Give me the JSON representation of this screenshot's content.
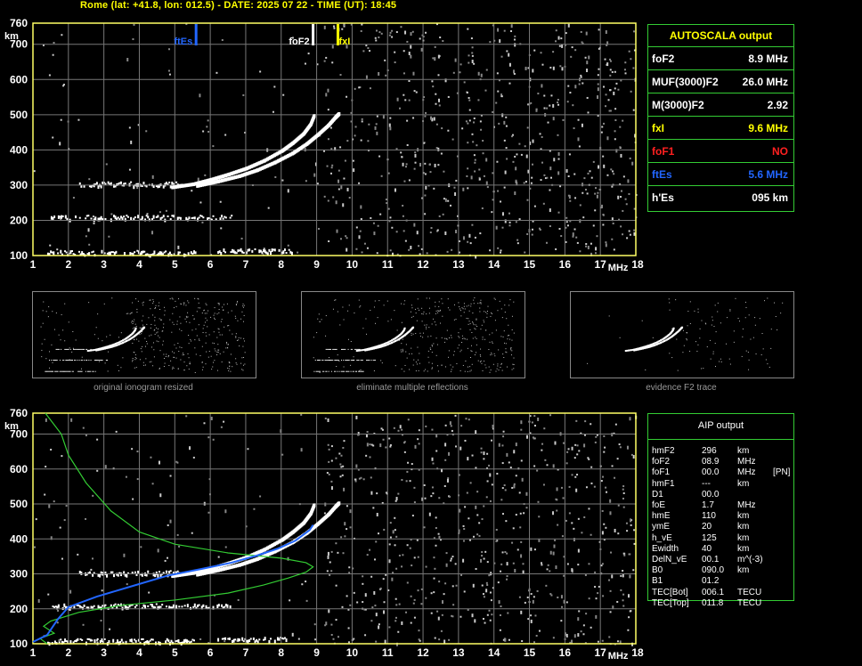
{
  "header": "Rome (lat: +41.8, lon: 012.5) - DATE: 2025 07 22 - TIME (UT): 18:45",
  "colors": {
    "frame": "#ffff66",
    "grid": "#777777",
    "green": "#33cc33",
    "blue": "#2266ff",
    "yellow": "#ffff00",
    "red": "#ff2020"
  },
  "chart_data": [
    {
      "type": "scatter",
      "xlabel": "MHz",
      "ylabel": "km",
      "xlim": [
        1,
        18
      ],
      "ylim": [
        100,
        760
      ],
      "xticks": [
        "1",
        "2",
        "3",
        "4",
        "5",
        "6",
        "7",
        "8",
        "9",
        "10",
        "11",
        "12",
        "13",
        "14",
        "15",
        "16",
        "17",
        "18"
      ],
      "yticks": [
        "100",
        "200",
        "300",
        "400",
        "500",
        "600",
        "700",
        "760"
      ],
      "grid": true,
      "markers": [
        {
          "label": "ftEs",
          "freq": 5.6,
          "color": "#2266ff"
        },
        {
          "label": "foF2",
          "freq": 8.9,
          "color": "#ffffff"
        },
        {
          "label": "fxI",
          "freq": 9.6,
          "color": "#ffff00"
        }
      ],
      "series": [
        {
          "x": [
            4.9,
            5.5,
            6.0,
            6.5,
            7.0,
            7.5,
            8.0,
            8.3,
            8.6,
            8.8,
            8.9
          ],
          "y": [
            296,
            305,
            318,
            333,
            350,
            372,
            400,
            422,
            448,
            475,
            500
          ]
        },
        {
          "x": [
            5.6,
            6.2,
            6.8,
            7.3,
            7.8,
            8.3,
            8.7,
            9.0,
            9.3,
            9.5,
            9.6
          ],
          "y": [
            300,
            313,
            328,
            345,
            367,
            393,
            420,
            445,
            472,
            495,
            505
          ]
        }
      ]
    },
    {
      "type": "line",
      "xlabel": "MHz",
      "ylabel": "km",
      "xlim": [
        1,
        18
      ],
      "ylim": [
        100,
        760
      ],
      "xticks": [
        "1",
        "2",
        "3",
        "4",
        "5",
        "6",
        "7",
        "8",
        "9",
        "10",
        "11",
        "12",
        "13",
        "14",
        "15",
        "16",
        "17",
        "18"
      ],
      "yticks": [
        "100",
        "200",
        "300",
        "400",
        "500",
        "600",
        "700",
        "760"
      ],
      "grid": true,
      "series": [
        {
          "color": "#33cc33",
          "x": [
            1.4,
            1.2,
            1.6,
            1.3,
            1.5,
            2.3,
            3.5,
            5.0,
            6.5,
            7.5,
            8.2,
            8.7,
            8.9,
            8.7,
            8.0,
            6.5,
            5.0,
            4.0,
            3.2,
            2.5,
            2.0,
            1.8,
            1.5,
            1.35
          ],
          "y": [
            100,
            115,
            130,
            150,
            165,
            190,
            210,
            225,
            245,
            268,
            288,
            305,
            320,
            332,
            345,
            360,
            385,
            420,
            480,
            560,
            640,
            700,
            740,
            760
          ]
        },
        {
          "color": "#2266ff",
          "x": [
            1.0,
            1.4,
            1.7,
            2.0,
            2.8,
            3.8,
            4.8,
            5.8,
            6.6,
            7.3,
            7.9,
            8.4,
            8.8,
            8.9
          ],
          "y": [
            105,
            125,
            170,
            205,
            235,
            265,
            295,
            315,
            332,
            352,
            372,
            395,
            425,
            440
          ]
        }
      ]
    }
  ],
  "autoscala": {
    "title": "AUTOSCALA output",
    "rows": [
      {
        "label": "foF2",
        "value": "8.9 MHz",
        "color": "#ffffff"
      },
      {
        "label": "MUF(3000)F2",
        "value": "26.0 MHz",
        "color": "#ffffff"
      },
      {
        "label": "M(3000)F2",
        "value": "2.92",
        "color": "#ffffff"
      },
      {
        "label": "fxI",
        "value": "9.6 MHz",
        "color": "#ffff00"
      },
      {
        "label": "foF1",
        "value": "NO",
        "color": "#ff2020"
      },
      {
        "label": "ftEs",
        "value": "5.6 MHz",
        "color": "#2266ff"
      },
      {
        "label": "h'Es",
        "value": "095     km",
        "color": "#ffffff"
      }
    ]
  },
  "thumbnails": [
    {
      "caption": "original ionogram resized"
    },
    {
      "caption": "eliminate multiple reflections"
    },
    {
      "caption": "evidence F2 trace"
    }
  ],
  "aip": {
    "title": "AIP output",
    "rows": [
      [
        "hmF2",
        "296",
        "km",
        ""
      ],
      [
        "foF2",
        "08.9",
        "MHz",
        ""
      ],
      [
        "foF1",
        "00.0",
        "MHz",
        "[PN]"
      ],
      [
        "hmF1",
        "---",
        "km",
        ""
      ],
      [
        "D1",
        "00.0",
        "",
        ""
      ],
      [
        "foE",
        "1.7",
        "MHz",
        ""
      ],
      [
        "hmE",
        "110",
        "km",
        ""
      ],
      [
        "ymE",
        "20",
        "km",
        ""
      ],
      [
        "h_vE",
        "125",
        "km",
        ""
      ],
      [
        "Ewidth",
        "40",
        "km",
        ""
      ],
      [
        "DelN_vE",
        "00.1",
        "m^(-3)",
        ""
      ],
      [
        "B0",
        "090.0",
        "km",
        ""
      ],
      [
        "B1",
        "01.2",
        "",
        ""
      ],
      [
        "TEC[Bot]",
        "006.1",
        "TECU",
        ""
      ],
      [
        "TEC[Top]",
        "011.8",
        "TECU",
        ""
      ]
    ]
  }
}
